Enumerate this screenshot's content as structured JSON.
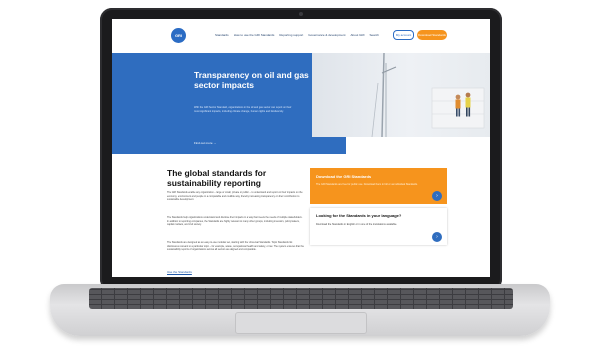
{
  "nav": {
    "logo": "GRI",
    "links": [
      "Standards",
      "How to use the GRI Standards",
      "Reporting support",
      "Governance & development",
      "About GRI",
      "Search"
    ],
    "login_label": "My account",
    "cta_label": "Download Standards"
  },
  "hero": {
    "title": "Transparency on oil and gas sector impacts",
    "body": "With the GRI Sector Standard, organizations in the oil and gas sector can report on their most significant impacts, including climate change, human rights and biodiversity.",
    "link": "Find out more →"
  },
  "main": {
    "title": "The global standards for sustainability reporting",
    "paragraphs": [
      "The GRI Standards enable any organization – large or small, private or public – to understand and report on their impacts on the economy, environment and people in a comparable and credible way, thereby increasing transparency on their contribution to sustainable development.",
      "The Standards help organizations understand and disclose their impacts in a way that meets the needs of multiple stakeholders. In addition to reporting companies, the Standards are highly relevant to many other groups, including investors, policymakers, capital markets, and civil society.",
      "The Standards are designed as an easy-to-use modular set, starting with the Universal Standards. Topic Standards list disclosures relevant to a particular topic – for example, waste, occupational health and safety, or tax. The system ensures that the sustainability reports of organizations across all sectors are aligned and comparable."
    ],
    "link": "Use the Standards"
  },
  "cards": {
    "download": {
      "title": "Download the GRI Standards",
      "body": "The GRI Standards are free for public use. Download them in full or as individual Standards."
    },
    "language": {
      "title": "Looking for the Standards in your language?",
      "body": "Download the Standards in English or in one of the translations available."
    }
  },
  "colors": {
    "brand_blue": "#2f6dbf",
    "accent_orange": "#f6941d"
  }
}
